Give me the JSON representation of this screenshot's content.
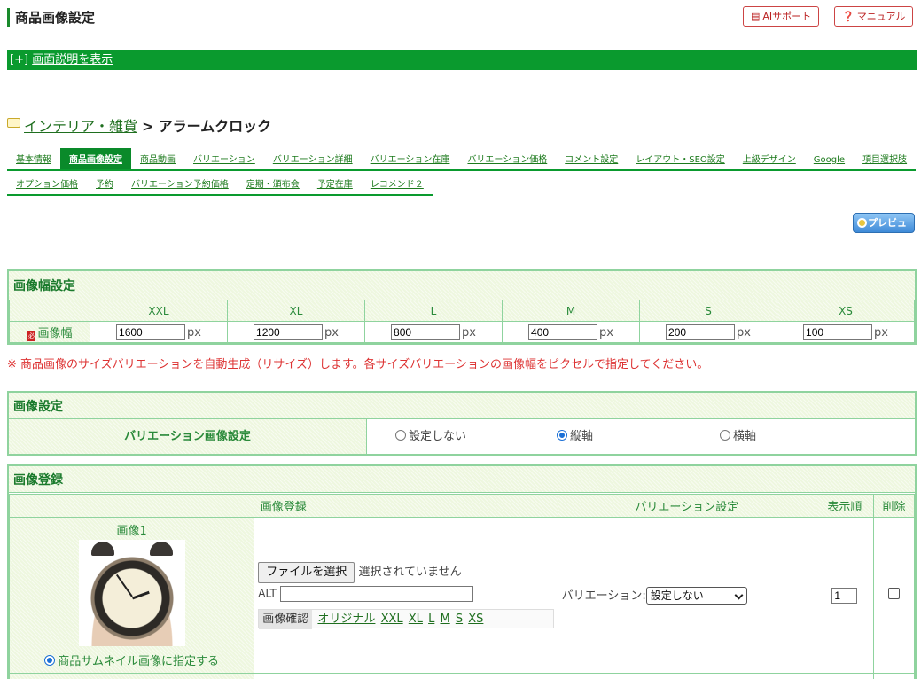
{
  "header": {
    "title": "商品画像設定",
    "ai_support": "AIサポート",
    "manual": "マニュアル"
  },
  "desc_bar": {
    "toggle": "[+]",
    "link": "画面説明を表示"
  },
  "breadcrumb": {
    "category": "インテリア・雑貨",
    "sep": ">",
    "product": "アラームクロック"
  },
  "tabs_row1": [
    {
      "label": "基本情報",
      "active": false
    },
    {
      "label": "商品画像設定",
      "active": true
    },
    {
      "label": "商品動画",
      "active": false
    },
    {
      "label": "バリエーション",
      "active": false
    },
    {
      "label": "バリエーション詳細",
      "active": false
    },
    {
      "label": "バリエーション在庫",
      "active": false
    },
    {
      "label": "バリエーション価格",
      "active": false
    },
    {
      "label": "コメント設定",
      "active": false
    },
    {
      "label": "レイアウト・SEO設定",
      "active": false
    },
    {
      "label": "上級デザイン",
      "active": false
    },
    {
      "label": "Google",
      "active": false
    },
    {
      "label": "項目選択肢",
      "active": false
    }
  ],
  "tabs_row2": [
    {
      "label": "オプション価格"
    },
    {
      "label": "予約"
    },
    {
      "label": "バリエーション予約価格"
    },
    {
      "label": "定期・頒布会"
    },
    {
      "label": "予定在庫"
    },
    {
      "label": "レコメンド２"
    }
  ],
  "preview_button": "プレビュー",
  "width_section": {
    "title": "画像幅設定",
    "row_label": "画像幅",
    "required_mark": "必",
    "unit": "px",
    "sizes": [
      {
        "name": "XXL",
        "value": "1600"
      },
      {
        "name": "XL",
        "value": "1200"
      },
      {
        "name": "L",
        "value": "800"
      },
      {
        "name": "M",
        "value": "400"
      },
      {
        "name": "S",
        "value": "200"
      },
      {
        "name": "XS",
        "value": "100"
      }
    ],
    "note": "※ 商品画像のサイズバリエーションを自動生成（リサイズ）します。各サイズバリエーションの画像幅をピクセルで指定してください。"
  },
  "image_settings": {
    "title": "画像設定",
    "label": "バリエーション画像設定",
    "options": [
      {
        "label": "設定しない",
        "selected": false
      },
      {
        "label": "縦軸",
        "selected": true
      },
      {
        "label": "横軸",
        "selected": false
      }
    ]
  },
  "registration": {
    "title": "画像登録",
    "columns": [
      "画像登録",
      "バリエーション設定",
      "表示順",
      "削除"
    ],
    "image1": {
      "label": "画像1",
      "thumbnail_label": "商品サムネイル画像に指定する",
      "thumbnail_selected": true,
      "file_button": "ファイルを選択",
      "file_status": "選択されていません",
      "alt_label": "ALT",
      "alt_value": "",
      "confirm_label": "画像確認",
      "links": [
        "オリジナル",
        "XXL",
        "XL",
        "L",
        "M",
        "S",
        "XS"
      ],
      "variation_label": "バリエーション:",
      "variation_value": "設定しない",
      "order": "1",
      "delete_checked": false
    }
  }
}
